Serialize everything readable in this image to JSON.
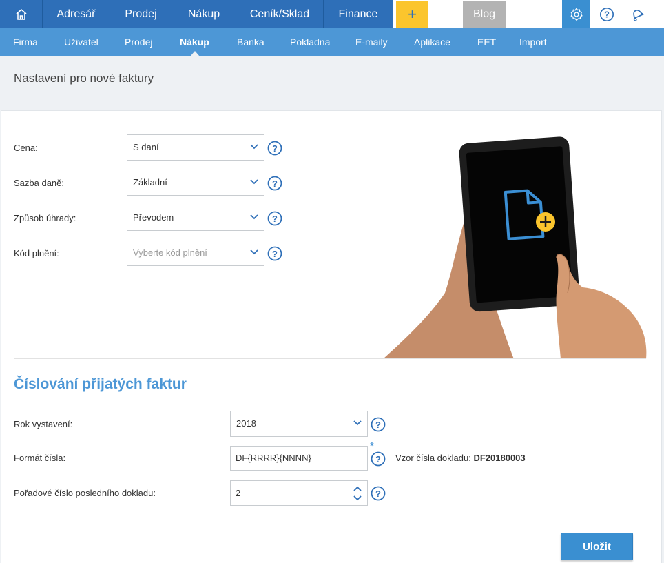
{
  "topnav": {
    "items": [
      "Adresář",
      "Prodej",
      "Nákup",
      "Ceník/Sklad",
      "Finance"
    ],
    "plus": "+",
    "blog": "Blog"
  },
  "subnav": {
    "items": [
      "Firma",
      "Uživatel",
      "Prodej",
      "Nákup",
      "Banka",
      "Pokladna",
      "E-maily",
      "Aplikace",
      "EET",
      "Import"
    ],
    "active": "Nákup"
  },
  "page": {
    "title": "Nastavení pro nové faktury"
  },
  "invoice_settings": {
    "cena_label": "Cena:",
    "cena_value": "S daní",
    "sazba_label": "Sazba daně:",
    "sazba_value": "Základní",
    "uhrada_label": "Způsob úhrady:",
    "uhrada_value": "Převodem",
    "kod_label": "Kód plnění:",
    "kod_placeholder": "Vyberte kód plnění"
  },
  "numbering": {
    "title": "Číslování přijatých faktur",
    "rok_label": "Rok vystavení:",
    "rok_value": "2018",
    "format_label": "Formát čísla:",
    "format_value": "DF{RRRR}{NNNN}",
    "required_mark": "*",
    "vzor_label": "Vzor čísla dokladu:",
    "vzor_value": "DF20180003",
    "poradove_label": "Pořadové číslo posledního dokladu:",
    "poradove_value": "2"
  },
  "actions": {
    "save": "Uložit"
  },
  "colors": {
    "primary": "#2e6fb8",
    "subnav": "#4d97d6",
    "accent": "#fbc52d"
  }
}
